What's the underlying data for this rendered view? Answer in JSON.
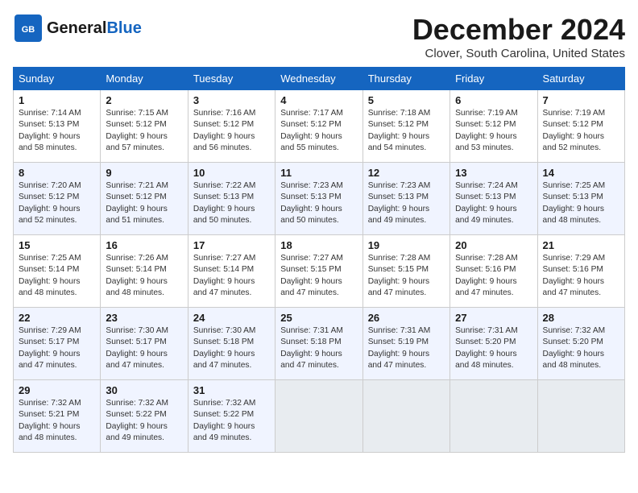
{
  "header": {
    "logo_general": "General",
    "logo_blue": "Blue",
    "title": "December 2024",
    "location": "Clover, South Carolina, United States"
  },
  "weekdays": [
    "Sunday",
    "Monday",
    "Tuesday",
    "Wednesday",
    "Thursday",
    "Friday",
    "Saturday"
  ],
  "weeks": [
    [
      {
        "day": "1",
        "info": "Sunrise: 7:14 AM\nSunset: 5:13 PM\nDaylight: 9 hours\nand 58 minutes."
      },
      {
        "day": "2",
        "info": "Sunrise: 7:15 AM\nSunset: 5:12 PM\nDaylight: 9 hours\nand 57 minutes."
      },
      {
        "day": "3",
        "info": "Sunrise: 7:16 AM\nSunset: 5:12 PM\nDaylight: 9 hours\nand 56 minutes."
      },
      {
        "day": "4",
        "info": "Sunrise: 7:17 AM\nSunset: 5:12 PM\nDaylight: 9 hours\nand 55 minutes."
      },
      {
        "day": "5",
        "info": "Sunrise: 7:18 AM\nSunset: 5:12 PM\nDaylight: 9 hours\nand 54 minutes."
      },
      {
        "day": "6",
        "info": "Sunrise: 7:19 AM\nSunset: 5:12 PM\nDaylight: 9 hours\nand 53 minutes."
      },
      {
        "day": "7",
        "info": "Sunrise: 7:19 AM\nSunset: 5:12 PM\nDaylight: 9 hours\nand 52 minutes."
      }
    ],
    [
      {
        "day": "8",
        "info": "Sunrise: 7:20 AM\nSunset: 5:12 PM\nDaylight: 9 hours\nand 52 minutes."
      },
      {
        "day": "9",
        "info": "Sunrise: 7:21 AM\nSunset: 5:12 PM\nDaylight: 9 hours\nand 51 minutes."
      },
      {
        "day": "10",
        "info": "Sunrise: 7:22 AM\nSunset: 5:13 PM\nDaylight: 9 hours\nand 50 minutes."
      },
      {
        "day": "11",
        "info": "Sunrise: 7:23 AM\nSunset: 5:13 PM\nDaylight: 9 hours\nand 50 minutes."
      },
      {
        "day": "12",
        "info": "Sunrise: 7:23 AM\nSunset: 5:13 PM\nDaylight: 9 hours\nand 49 minutes."
      },
      {
        "day": "13",
        "info": "Sunrise: 7:24 AM\nSunset: 5:13 PM\nDaylight: 9 hours\nand 49 minutes."
      },
      {
        "day": "14",
        "info": "Sunrise: 7:25 AM\nSunset: 5:13 PM\nDaylight: 9 hours\nand 48 minutes."
      }
    ],
    [
      {
        "day": "15",
        "info": "Sunrise: 7:25 AM\nSunset: 5:14 PM\nDaylight: 9 hours\nand 48 minutes."
      },
      {
        "day": "16",
        "info": "Sunrise: 7:26 AM\nSunset: 5:14 PM\nDaylight: 9 hours\nand 48 minutes."
      },
      {
        "day": "17",
        "info": "Sunrise: 7:27 AM\nSunset: 5:14 PM\nDaylight: 9 hours\nand 47 minutes."
      },
      {
        "day": "18",
        "info": "Sunrise: 7:27 AM\nSunset: 5:15 PM\nDaylight: 9 hours\nand 47 minutes."
      },
      {
        "day": "19",
        "info": "Sunrise: 7:28 AM\nSunset: 5:15 PM\nDaylight: 9 hours\nand 47 minutes."
      },
      {
        "day": "20",
        "info": "Sunrise: 7:28 AM\nSunset: 5:16 PM\nDaylight: 9 hours\nand 47 minutes."
      },
      {
        "day": "21",
        "info": "Sunrise: 7:29 AM\nSunset: 5:16 PM\nDaylight: 9 hours\nand 47 minutes."
      }
    ],
    [
      {
        "day": "22",
        "info": "Sunrise: 7:29 AM\nSunset: 5:17 PM\nDaylight: 9 hours\nand 47 minutes."
      },
      {
        "day": "23",
        "info": "Sunrise: 7:30 AM\nSunset: 5:17 PM\nDaylight: 9 hours\nand 47 minutes."
      },
      {
        "day": "24",
        "info": "Sunrise: 7:30 AM\nSunset: 5:18 PM\nDaylight: 9 hours\nand 47 minutes."
      },
      {
        "day": "25",
        "info": "Sunrise: 7:31 AM\nSunset: 5:18 PM\nDaylight: 9 hours\nand 47 minutes."
      },
      {
        "day": "26",
        "info": "Sunrise: 7:31 AM\nSunset: 5:19 PM\nDaylight: 9 hours\nand 47 minutes."
      },
      {
        "day": "27",
        "info": "Sunrise: 7:31 AM\nSunset: 5:20 PM\nDaylight: 9 hours\nand 48 minutes."
      },
      {
        "day": "28",
        "info": "Sunrise: 7:32 AM\nSunset: 5:20 PM\nDaylight: 9 hours\nand 48 minutes."
      }
    ],
    [
      {
        "day": "29",
        "info": "Sunrise: 7:32 AM\nSunset: 5:21 PM\nDaylight: 9 hours\nand 48 minutes."
      },
      {
        "day": "30",
        "info": "Sunrise: 7:32 AM\nSunset: 5:22 PM\nDaylight: 9 hours\nand 49 minutes."
      },
      {
        "day": "31",
        "info": "Sunrise: 7:32 AM\nSunset: 5:22 PM\nDaylight: 9 hours\nand 49 minutes."
      },
      {
        "day": "",
        "info": ""
      },
      {
        "day": "",
        "info": ""
      },
      {
        "day": "",
        "info": ""
      },
      {
        "day": "",
        "info": ""
      }
    ]
  ]
}
